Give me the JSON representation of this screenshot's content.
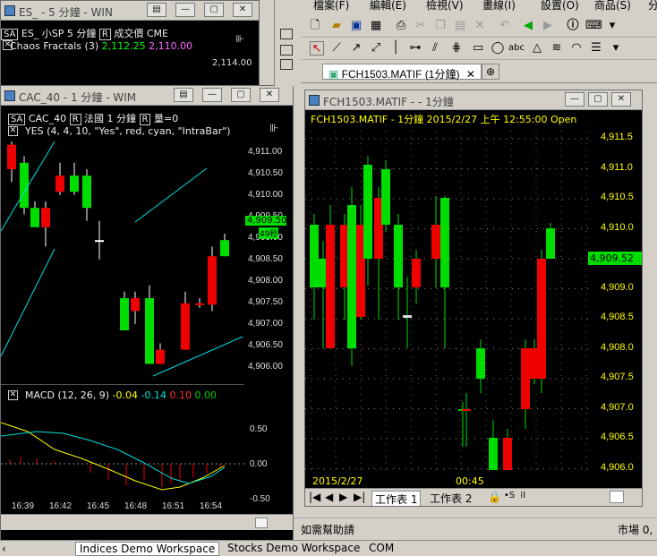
{
  "win_es": {
    "title": "ES_ - 5 分鐘 - WIN",
    "info": "ES_   小SP 5 分鐘",
    "box1": "SA",
    "box2": "R",
    "box3": "成交價",
    "extra": "CME",
    "ind": "Chaos Fractals  (3)",
    "v1": "2,112.25",
    "v2": "2,110.00",
    "price": "2,114.00"
  },
  "win_cac": {
    "title": "CAC_40 - 1 分鐘 - WIM",
    "header_sym": "CAC_40",
    "header_cty": "法國",
    "header_tf": "1 分鐘",
    "header_vol": "量=0",
    "box_sa": "SA",
    "box_r1": "R",
    "box_r2": "R",
    "indicator": "YES  (4, 4, 10, \"Yes\", red, cyan, \"IntraBar\")",
    "price_labels": [
      "4,911.00",
      "4,910.50",
      "4,910.00",
      "4,909.50",
      "4,909.00",
      "4,908.50",
      "4,908.00",
      "4,907.50",
      "4,907.00",
      "4,906.50",
      "4,906.00"
    ],
    "last_price": "4,909.50",
    "last_tag": "49秒",
    "macd_label": "MACD  (12, 26, 9)",
    "macd_v1": "-0.04",
    "macd_v2": "-0.14",
    "macd_v3": "0.10",
    "macd_v4": "0.00",
    "macd_ticks": [
      "0.50",
      "0.00",
      "-0.50"
    ],
    "time_labels": [
      "16:39",
      "16:42",
      "16:45",
      "16:48",
      "16:51",
      "16:54"
    ]
  },
  "menu": {
    "file": "檔案(F)",
    "edit": "編輯(E)",
    "view": "檢視(V)",
    "draw": "畫線(I)",
    "settings": "設置(O)",
    "product": "商品(S)",
    "analysis": "分析(A"
  },
  "win_fch": {
    "tab": "FCH1503.MATIF (1分鐘)",
    "title": "FCH1503.MATIF - - 1分鐘",
    "header": "FCH1503.MATIF - 1分鐘  2015/2/27 上午 12:55:00 Open",
    "price_labels": [
      "4,911.5",
      "4,911.0",
      "4,910.5",
      "4,910.0",
      "4,909.5",
      "4,909.0",
      "4,908.5",
      "4,908.0",
      "4,907.5",
      "4,907.0",
      "4,906.5",
      "4,906.0"
    ],
    "last_price": "4,909.52",
    "date_label": "2015/2/27",
    "time_label": "00:45",
    "sheet1": "工作表 1",
    "sheet2": "工作表 2"
  },
  "status": {
    "help": "如需幫助請",
    "market": "市場 0,"
  },
  "workspace_tabs": [
    "Indices Demo Workspace",
    "Stocks Demo Workspace",
    "COM"
  ],
  "colors": {
    "up": "#00dd00",
    "down": "#ee0000",
    "cyan": "#00e0e0",
    "yellow": "#ffff00"
  }
}
